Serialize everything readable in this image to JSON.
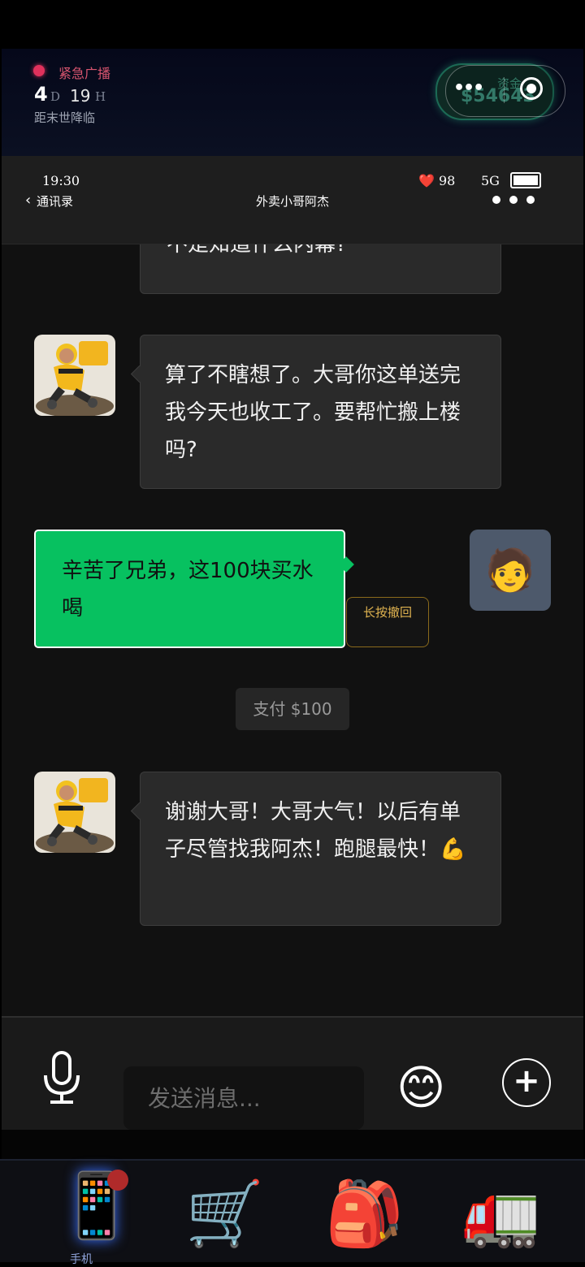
{
  "broadcast": {
    "label": "紧急广播",
    "days": "4",
    "days_unit": "D",
    "hours": "19",
    "hours_unit": "H",
    "subtitle": "距末世降临"
  },
  "funds": {
    "label": "资金",
    "value": "$54643"
  },
  "capsule": {
    "more_glyph": "•••"
  },
  "status_bar": {
    "time": "19:30",
    "heart_icon": "❤️",
    "health": "98",
    "signal": "5G"
  },
  "nav_header": {
    "back_chevron": "‹",
    "back_label": "通讯录",
    "title": "外卖小哥阿杰"
  },
  "messages": [
    {
      "from": "contact",
      "text": "不是知道什么内幕?"
    },
    {
      "from": "contact",
      "text": "算了不瞎想了。大哥你这单送完我今天也收工了。要帮忙搬上楼吗?"
    },
    {
      "from": "self",
      "text": "辛苦了兄弟，这100块买水喝",
      "recall_hint": "长按撤回"
    },
    {
      "from": "system",
      "text": "支付 $100"
    },
    {
      "from": "contact",
      "text": "谢谢大哥！大哥大气！以后有单子尽管找我阿杰！跑腿最快！💪"
    }
  ],
  "self_avatar_emoji": "🧑",
  "input": {
    "placeholder": "发送消息...",
    "emoji_glyph": "😊",
    "plus_glyph": "+"
  },
  "bottom_nav": {
    "phone_icon": "📱",
    "phone_label": "手机",
    "cart_icon": "🛒",
    "bag_icon": "🎒",
    "truck_icon": "🚛"
  },
  "colors": {
    "accent_green": "#07c160",
    "alert_red": "#e0315c",
    "recall_gold": "#e0b350"
  }
}
